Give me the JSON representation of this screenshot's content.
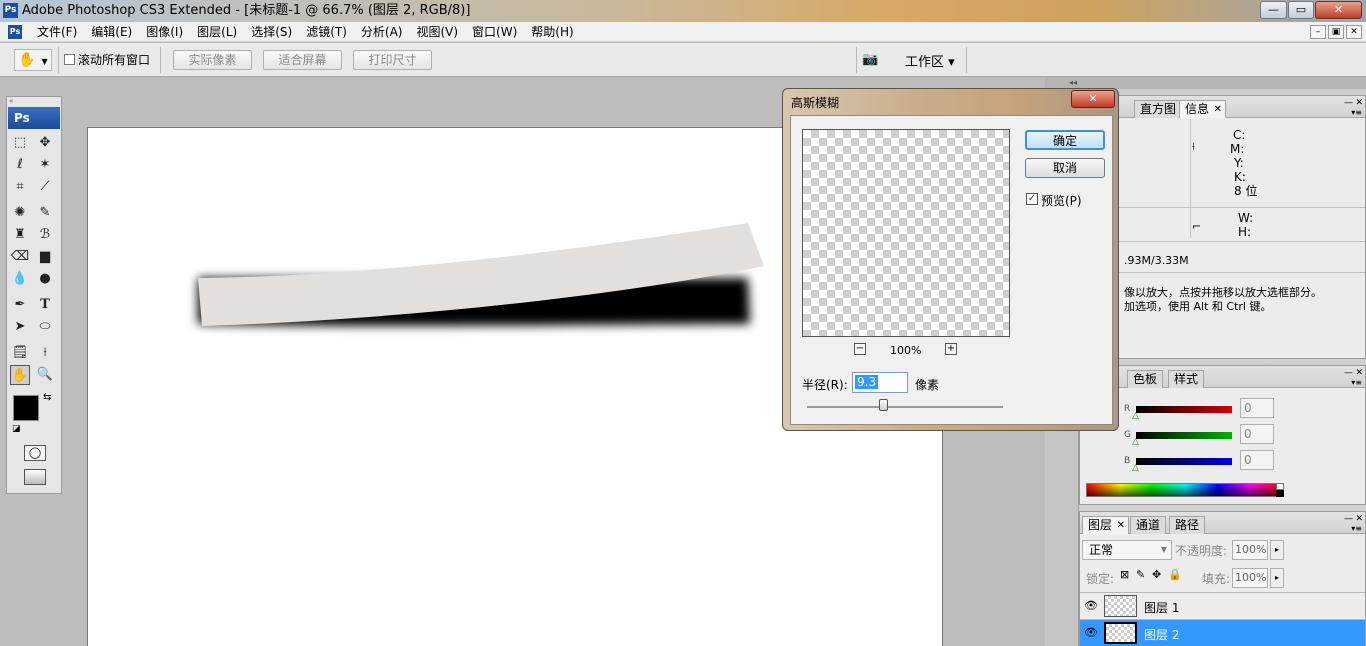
{
  "window": {
    "title": "Adobe Photoshop CS3 Extended - [未标题-1 @ 66.7% (图层 2, RGB/8)]",
    "app_icon": "Ps",
    "controls": [
      "minimize-icon",
      "maximize-icon",
      "close-icon"
    ]
  },
  "menubar": {
    "items": [
      "文件(F)",
      "编辑(E)",
      "图像(I)",
      "图层(L)",
      "选择(S)",
      "滤镜(T)",
      "分析(A)",
      "视图(V)",
      "窗口(W)",
      "帮助(H)"
    ]
  },
  "optionsbar": {
    "checkbox_label": "滚动所有窗口",
    "buttons": [
      "实际像素",
      "适合屏幕",
      "打印尺寸"
    ],
    "workspace_label": "工作区 ▾"
  },
  "toolbox": {
    "logo": "Ps"
  },
  "dialog": {
    "title": "高斯模糊",
    "ok_label": "确定",
    "cancel_label": "取消",
    "preview_label": "预览(P)",
    "preview_checked": true,
    "zoom_minus": "−",
    "zoom_value": "100%",
    "zoom_plus": "+",
    "radius_label": "半径(R):",
    "radius_value": "9.3",
    "radius_unit": "像素",
    "radius_slider_fraction": 0.39
  },
  "info_panel": {
    "tabs": [
      "直方图",
      "信息"
    ],
    "cmyk": [
      "C:",
      "M:",
      "Y:",
      "K:"
    ],
    "bit_depth": "8 位",
    "wh": [
      "W:",
      "H:"
    ],
    "doc_size": ".93M/3.33M",
    "hint_line1": "像以放大，点按并拖移以放大选框部分。",
    "hint_line2": "加选项，使用 Alt 和 Ctrl 键。"
  },
  "color_panel": {
    "tabs": [
      "色板",
      "样式"
    ],
    "channels": [
      {
        "label": "R",
        "value": "0",
        "color": "#d40000"
      },
      {
        "label": "G",
        "value": "0",
        "color": "#00b400"
      },
      {
        "label": "B",
        "value": "0",
        "color": "#0000d4"
      }
    ]
  },
  "layers_panel": {
    "tabs": [
      "图层",
      "通道",
      "路径"
    ],
    "blend_mode": "正常",
    "opacity_label": "不透明度:",
    "opacity_value": "100%",
    "lock_label": "锁定:",
    "fill_label": "填充:",
    "fill_value": "100%",
    "layers": [
      {
        "name": "图层 1",
        "selected": false
      },
      {
        "name": "图层 2",
        "selected": true
      }
    ]
  },
  "colors": {
    "selection_blue": "#3399ff",
    "ps_blue": "#1d4f9a"
  }
}
